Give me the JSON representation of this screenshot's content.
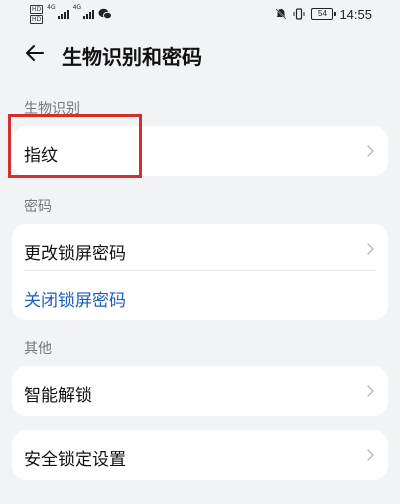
{
  "status_bar": {
    "sim1_badge": "HD",
    "sim2_badge": "HD",
    "network1": "4G",
    "network2": "4G",
    "battery": "54",
    "time": "14:55",
    "icons": [
      "signal-icon",
      "wechat-icon",
      "mute-alarm-icon",
      "vibrate-icon",
      "battery-icon"
    ]
  },
  "header": {
    "title": "生物识别和密码",
    "back_icon": "arrow-left-icon"
  },
  "sections": {
    "biometrics": {
      "label": "生物识别",
      "items": [
        {
          "label": "指纹"
        }
      ]
    },
    "password": {
      "label": "密码",
      "items": [
        {
          "label": "更改锁屏密码"
        },
        {
          "label": "关闭锁屏密码"
        }
      ]
    },
    "other": {
      "label": "其他",
      "items": [
        {
          "label": "智能解锁"
        }
      ]
    },
    "security": {
      "items": [
        {
          "label": "安全锁定设置"
        }
      ]
    }
  },
  "colors": {
    "background": "#f1f3f5",
    "card": "#ffffff",
    "link": "#1b5dbf",
    "highlight": "#d32f2f"
  }
}
